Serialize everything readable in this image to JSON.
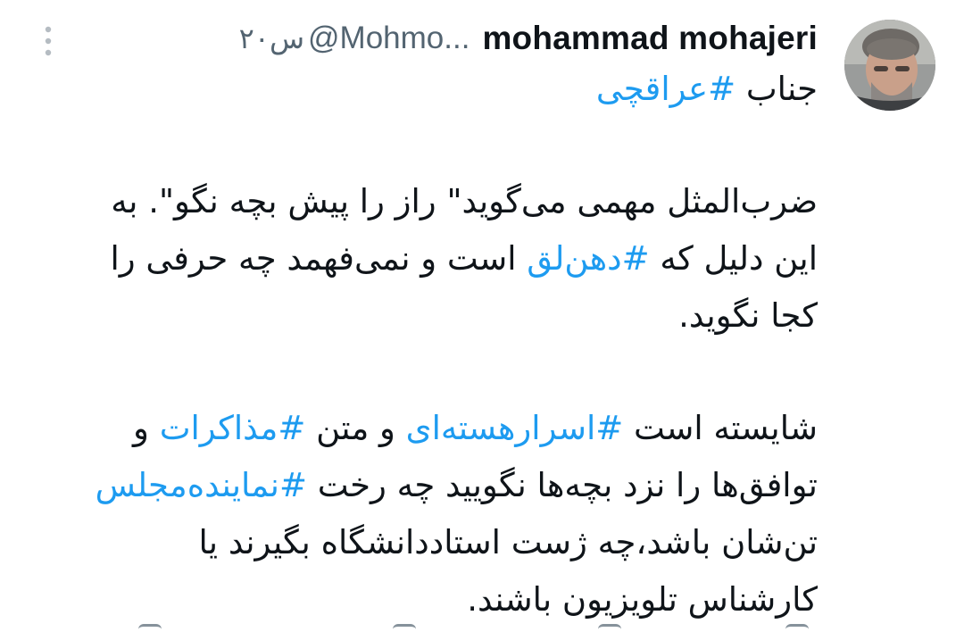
{
  "author": {
    "display_name": "mohammad mohajeri",
    "handle": "@Mohmo...",
    "time": "۲۰س"
  },
  "icons": {
    "more": "more-vertical-icon",
    "avatar": "profile-photo"
  },
  "colors": {
    "hashtag": "#1d9bf0",
    "text": "#0f1419",
    "secondary": "#536471"
  },
  "tweet": {
    "p1": {
      "t1": "جناب ",
      "h1": "#عراقچی"
    },
    "p2": {
      "l1": "ضرب‌المثل مهمی  می‌گوید\" راز را پیش بچه نگو\". به",
      "l2a": "این دلیل که ",
      "l2h": "#دهن‌لق",
      "l2b": " است و نمی‌فهمد چه حرفی را",
      "l3": "کجا نگوید."
    },
    "p3": {
      "l1a": "شایسته است ",
      "l1h1": "#اسرارهسته‌ای",
      "l1b": " و متن ",
      "l1h2": "#مذاکرات",
      "l1c": " و",
      "l2a": "توافق‌ها را نزد بچه‌ها نگویید چه رخت ",
      "l2h": "#نماینده‌مجلس",
      "l3": "تن‌شان باشد،چه ژست استاددانشگاه بگیرند یا",
      "l4": "کارشناس تلویزیون باشند."
    }
  }
}
